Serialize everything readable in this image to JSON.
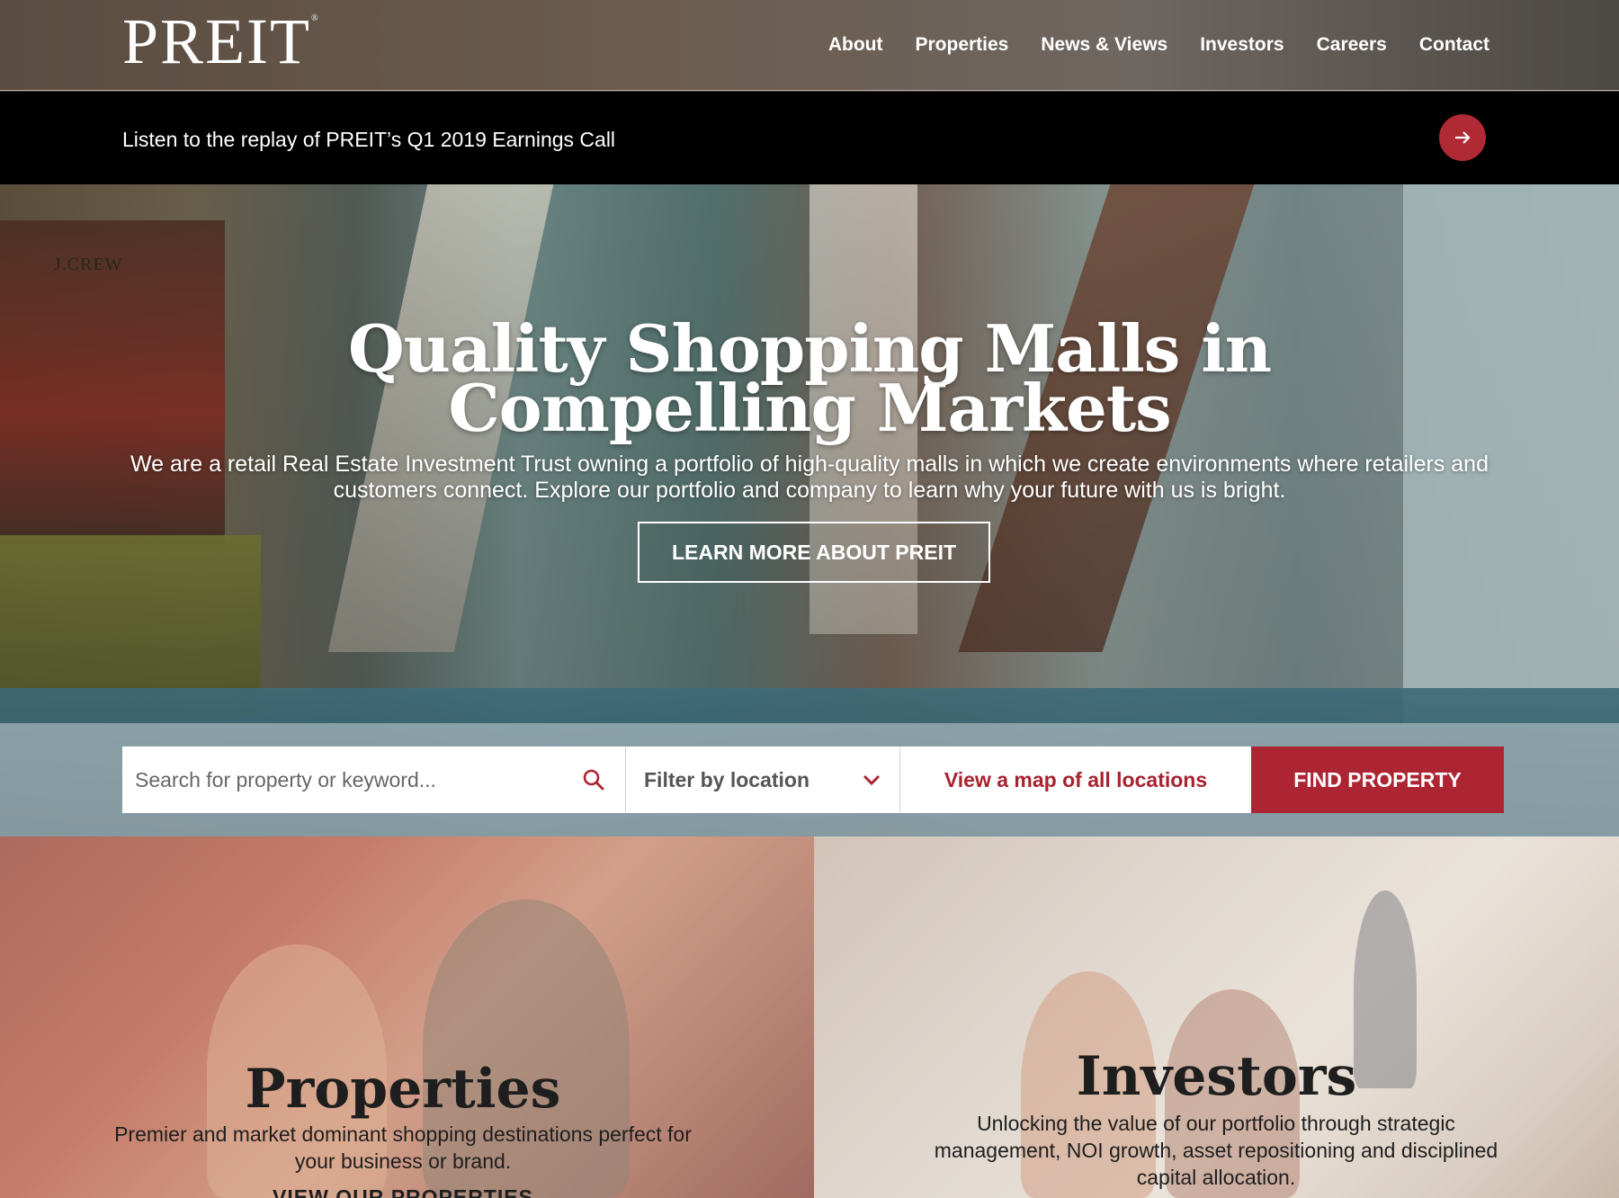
{
  "header": {
    "logo": "PREIT",
    "logo_mark": "®",
    "nav": [
      "About",
      "Properties",
      "News & Views",
      "Investors",
      "Careers",
      "Contact"
    ]
  },
  "announcement": {
    "text": "Listen to the replay of PREIT’s Q1 2019 Earnings Call"
  },
  "hero": {
    "sign": "J.CREW",
    "title": "Quality Shopping Malls in Compelling Markets",
    "description": "We are a retail Real Estate Investment Trust owning a portfolio of high-quality malls in which we create environments where retailers and customers connect. Explore our portfolio and company to learn why your future with us is bright.",
    "cta": "LEARN MORE ABOUT PREIT"
  },
  "search": {
    "placeholder": "Search for property or keyword...",
    "filter_label": "Filter by location",
    "map_link": "View a map of all locations",
    "find_button": "FIND PROPERTY"
  },
  "panels": {
    "properties": {
      "title": "Properties",
      "description": "Premier and market dominant shopping destinations perfect for your business or brand.",
      "link": "VIEW OUR PROPERTIES"
    },
    "investors": {
      "title": "Investors",
      "description": "Unlocking the value of our portfolio through strategic management, NOI growth, asset repositioning and disciplined capital allocation."
    }
  },
  "colors": {
    "accent": "#ad2532",
    "announcement_bg": "#000000"
  },
  "icons": [
    "arrow-right-icon",
    "search-icon",
    "chevron-down-icon"
  ]
}
